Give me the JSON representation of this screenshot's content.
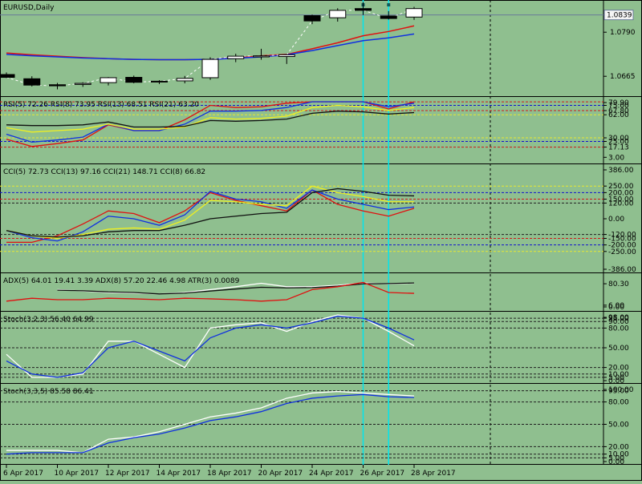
{
  "window": {
    "title": "EURUSD,Daily"
  },
  "colors": {
    "background": "#8fbf8f",
    "grid_red": "#d01818",
    "grid_blue": "#1010d0",
    "grid_yellow": "#e8e830",
    "grid_black": "#202020",
    "series_red": "#e01010",
    "series_blue": "#1030e0",
    "series_yellow": "#f0f020",
    "series_black": "#101010",
    "series_white": "#ffffff",
    "cursor_cyan": "#00e5ee"
  },
  "x_axis": {
    "labels": [
      "6 Apr 2017",
      "10 Apr 2017",
      "12 Apr 2017",
      "14 Apr 2017",
      "18 Apr 2017",
      "20 Apr 2017",
      "24 Apr 2017",
      "26 Apr 2017",
      "28 Apr 2017"
    ]
  },
  "chart_data": [
    {
      "type": "candlestick",
      "title": "EURUSD,Daily",
      "current_price": "1.0839",
      "y_ticks": [
        "1.0790",
        "1.0665"
      ],
      "ylim": [
        1.062,
        1.087
      ],
      "ohlc": [
        [
          1.067,
          1.0676,
          1.066,
          1.0662
        ],
        [
          1.0658,
          1.0665,
          1.0636,
          1.064
        ],
        [
          1.0641,
          1.0646,
          1.0628,
          1.0638
        ],
        [
          1.0642,
          1.0648,
          1.0635,
          1.0645
        ],
        [
          1.0647,
          1.0663,
          1.0639,
          1.0661
        ],
        [
          1.0662,
          1.0667,
          1.0645,
          1.0648
        ],
        [
          1.065,
          1.0654,
          1.0643,
          1.0651
        ],
        [
          1.0652,
          1.0666,
          1.0645,
          1.0659
        ],
        [
          1.0661,
          1.0719,
          1.0655,
          1.0713
        ],
        [
          1.0715,
          1.0729,
          1.0705,
          1.0722
        ],
        [
          1.072,
          1.0743,
          1.0712,
          1.0723
        ],
        [
          1.0721,
          1.0728,
          1.07,
          1.0726
        ],
        [
          1.0837,
          1.084,
          1.0813,
          1.0822
        ],
        [
          1.0831,
          1.0858,
          1.082,
          1.0852
        ],
        [
          1.0857,
          1.0875,
          1.0839,
          1.0852
        ],
        [
          1.0836,
          1.085,
          1.0826,
          1.0829
        ],
        [
          1.0833,
          1.0862,
          1.0825,
          1.0857
        ]
      ],
      "series": [
        {
          "color": "red",
          "values": [
            1.0731,
            1.0726,
            1.0722,
            1.0718,
            1.0715,
            1.0713,
            1.0712,
            1.0712,
            1.0713,
            1.0717,
            1.0723,
            1.0727,
            1.0743,
            1.076,
            1.078,
            1.0792,
            1.0808
          ]
        },
        {
          "color": "blue",
          "values": [
            1.0727,
            1.0723,
            1.072,
            1.0717,
            1.0715,
            1.0713,
            1.0712,
            1.0712,
            1.0713,
            1.0716,
            1.072,
            1.0726,
            1.0738,
            1.0752,
            1.0766,
            1.0774,
            1.0785
          ]
        }
      ]
    },
    {
      "type": "line",
      "title": "RSI(5) 72.26 RSI(8) 73.95 RSI(13) 68.51 RSI(21) 63.20",
      "y_ticks": [
        "79.90",
        "75.00",
        "67.80",
        "62.00",
        "30.00",
        "25.00",
        "17.13",
        "3.00"
      ],
      "ylim": [
        0,
        80
      ],
      "levels": [
        {
          "value": 79.9,
          "color": "red"
        },
        {
          "value": 75,
          "color": "blue"
        },
        {
          "value": 67.8,
          "color": "red"
        },
        {
          "value": 62,
          "color": "yellow"
        },
        {
          "value": 30,
          "color": "yellow"
        },
        {
          "value": 25,
          "color": "blue"
        },
        {
          "value": 17.13,
          "color": "red"
        }
      ],
      "series": [
        {
          "color": "red",
          "values": [
            28,
            18,
            22,
            27,
            48,
            40,
            40,
            55,
            75,
            72,
            73,
            78,
            95,
            100,
            80,
            70,
            80
          ]
        },
        {
          "color": "blue",
          "values": [
            35,
            24,
            27,
            31,
            49,
            40,
            40,
            49,
            67,
            67,
            68,
            72,
            85,
            88,
            82,
            73,
            78
          ]
        },
        {
          "color": "yellow",
          "values": [
            44,
            38,
            40,
            42,
            49,
            42,
            42,
            45,
            58,
            56,
            57,
            60,
            72,
            75,
            73,
            68,
            72
          ]
        },
        {
          "color": "black",
          "values": [
            48,
            47,
            47,
            48,
            52,
            45,
            45,
            46,
            54,
            53,
            54,
            56,
            64,
            67,
            66,
            63,
            65
          ]
        }
      ]
    },
    {
      "type": "line",
      "title": "CCI(5) 72.73 CCI(13) 97.16 CCI(21) 148.71 CCI(8) 66.82",
      "y_ticks": [
        "386.00",
        "250.00",
        "200.00",
        "150.00",
        "120.00",
        "0.00",
        "-120.00",
        "-150.00",
        "-200.00",
        "-250.00",
        "-386.00"
      ],
      "ylim": [
        -386,
        386
      ],
      "levels": [
        {
          "value": 250,
          "color": "yellow"
        },
        {
          "value": 200,
          "color": "blue"
        },
        {
          "value": 150,
          "color": "red"
        },
        {
          "value": 120,
          "color": "black"
        },
        {
          "value": -120,
          "color": "black"
        },
        {
          "value": -150,
          "color": "red"
        },
        {
          "value": -200,
          "color": "blue"
        },
        {
          "value": -250,
          "color": "yellow"
        }
      ],
      "series": [
        {
          "color": "red",
          "values": [
            -180,
            -180,
            -130,
            -40,
            60,
            40,
            -30,
            60,
            200,
            140,
            100,
            60,
            220,
            110,
            60,
            20,
            80
          ]
        },
        {
          "color": "blue",
          "values": [
            -90,
            -145,
            -170,
            -100,
            20,
            0,
            -50,
            30,
            210,
            150,
            130,
            80,
            220,
            150,
            110,
            70,
            90
          ]
        },
        {
          "color": "yellow",
          "values": [
            -90,
            -130,
            -150,
            -120,
            -80,
            -70,
            -80,
            -10,
            140,
            130,
            110,
            100,
            250,
            200,
            170,
            130,
            130
          ]
        },
        {
          "color": "black",
          "values": [
            -90,
            -130,
            -140,
            -130,
            -100,
            -90,
            -90,
            -50,
            0,
            20,
            40,
            50,
            200,
            230,
            210,
            180,
            175
          ]
        }
      ]
    },
    {
      "type": "line",
      "title": "ADX(5) 64.01 19.41 3.39 ADX(8) 57.20 22.46 4.98 ATR(3) 0.0089",
      "y_ticks": [
        "80.30",
        "6.00",
        "0.00"
      ],
      "ylim": [
        0,
        100
      ],
      "series": [
        {
          "color": "white",
          "values": [
            null,
            null,
            60,
            55,
            50,
            48,
            45,
            50,
            60,
            70,
            82,
            70,
            70,
            75,
            83,
            80,
            82
          ]
        },
        {
          "color": "black",
          "values": [
            null,
            null,
            58,
            56,
            52,
            50,
            45,
            48,
            55,
            62,
            68,
            66,
            67,
            72,
            80,
            81,
            83
          ]
        },
        {
          "color": "red",
          "values": [
            20,
            30,
            25,
            25,
            30,
            28,
            25,
            30,
            28,
            25,
            20,
            25,
            60,
            70,
            85,
            50,
            47
          ]
        }
      ]
    },
    {
      "type": "line",
      "title": "Stoch(3,2,3) 56.40 64.99",
      "y_ticks": [
        "98.00",
        "95.00",
        "90.00",
        "80.00",
        "50.00",
        "20.00",
        "10.00",
        "5.00",
        "0.00"
      ],
      "ylim": [
        0,
        100
      ],
      "levels": [
        {
          "value": 95,
          "color": "black"
        },
        {
          "value": 90,
          "color": "black"
        },
        {
          "value": 80,
          "color": "black"
        },
        {
          "value": 50,
          "color": "black"
        },
        {
          "value": 20,
          "color": "black"
        },
        {
          "value": 10,
          "color": "black"
        },
        {
          "value": 5,
          "color": "black"
        }
      ],
      "series": [
        {
          "color": "white",
          "values": [
            40,
            5,
            5,
            10,
            60,
            60,
            40,
            20,
            80,
            85,
            88,
            75,
            90,
            100,
            95,
            75,
            53
          ]
        },
        {
          "color": "blue",
          "values": [
            30,
            10,
            5,
            12,
            50,
            60,
            45,
            30,
            65,
            80,
            85,
            80,
            88,
            98,
            95,
            80,
            62
          ]
        }
      ]
    },
    {
      "type": "line",
      "title": "Stoch(3,3,5) 85.58 86.41",
      "y_ticks": [
        "100.00",
        "95.00",
        "80.00",
        "50.00",
        "20.00",
        "10.00",
        "5.00",
        "0.00"
      ],
      "ylim": [
        0,
        100
      ],
      "levels": [
        {
          "value": 95,
          "color": "black"
        },
        {
          "value": 80,
          "color": "black"
        },
        {
          "value": 50,
          "color": "black"
        },
        {
          "value": 20,
          "color": "black"
        },
        {
          "value": 10,
          "color": "black"
        },
        {
          "value": 5,
          "color": "black"
        }
      ],
      "series": [
        {
          "color": "white",
          "values": [
            15,
            15,
            15,
            12,
            30,
            33,
            40,
            50,
            60,
            65,
            72,
            85,
            92,
            94,
            92,
            90,
            88
          ]
        },
        {
          "color": "blue",
          "values": [
            10,
            12,
            12,
            12,
            25,
            32,
            37,
            45,
            55,
            60,
            67,
            78,
            85,
            88,
            90,
            87,
            86
          ]
        }
      ]
    }
  ]
}
